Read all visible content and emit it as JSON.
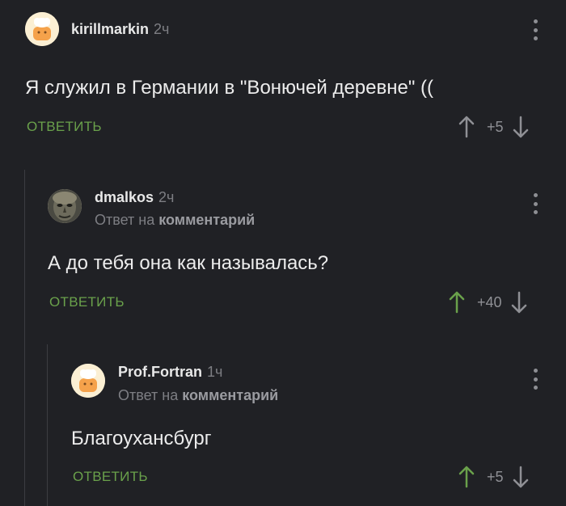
{
  "colors": {
    "background": "#202125",
    "accent_green": "#6aa14b",
    "muted": "#7d7e83",
    "thread_line": "#3c3d42"
  },
  "comments": [
    {
      "username": "kirillmarkin",
      "time": "2ч",
      "avatar_icon": "default-chef-avatar-icon",
      "reply_prefix": "",
      "reply_target": "",
      "text": "Я служил в Германии в \"Вонючей деревне\" ((",
      "reply_label": "ОТВЕТИТЬ",
      "score": "+5",
      "upvoted": false
    },
    {
      "username": "dmalkos",
      "time": "2ч",
      "avatar_icon": "photo-avatar-icon",
      "reply_prefix": "Ответ на",
      "reply_target": "комментарий",
      "text": "А до тебя она как называлась?",
      "reply_label": "ОТВЕТИТЬ",
      "score": "+40",
      "upvoted": true
    },
    {
      "username": "Prof.Fortran",
      "time": "1ч",
      "avatar_icon": "default-chef-avatar-icon",
      "reply_prefix": "Ответ на",
      "reply_target": "комментарий",
      "text": "Благоухансбург",
      "reply_label": "ОТВЕТИТЬ",
      "score": "+5",
      "upvoted": true
    }
  ]
}
